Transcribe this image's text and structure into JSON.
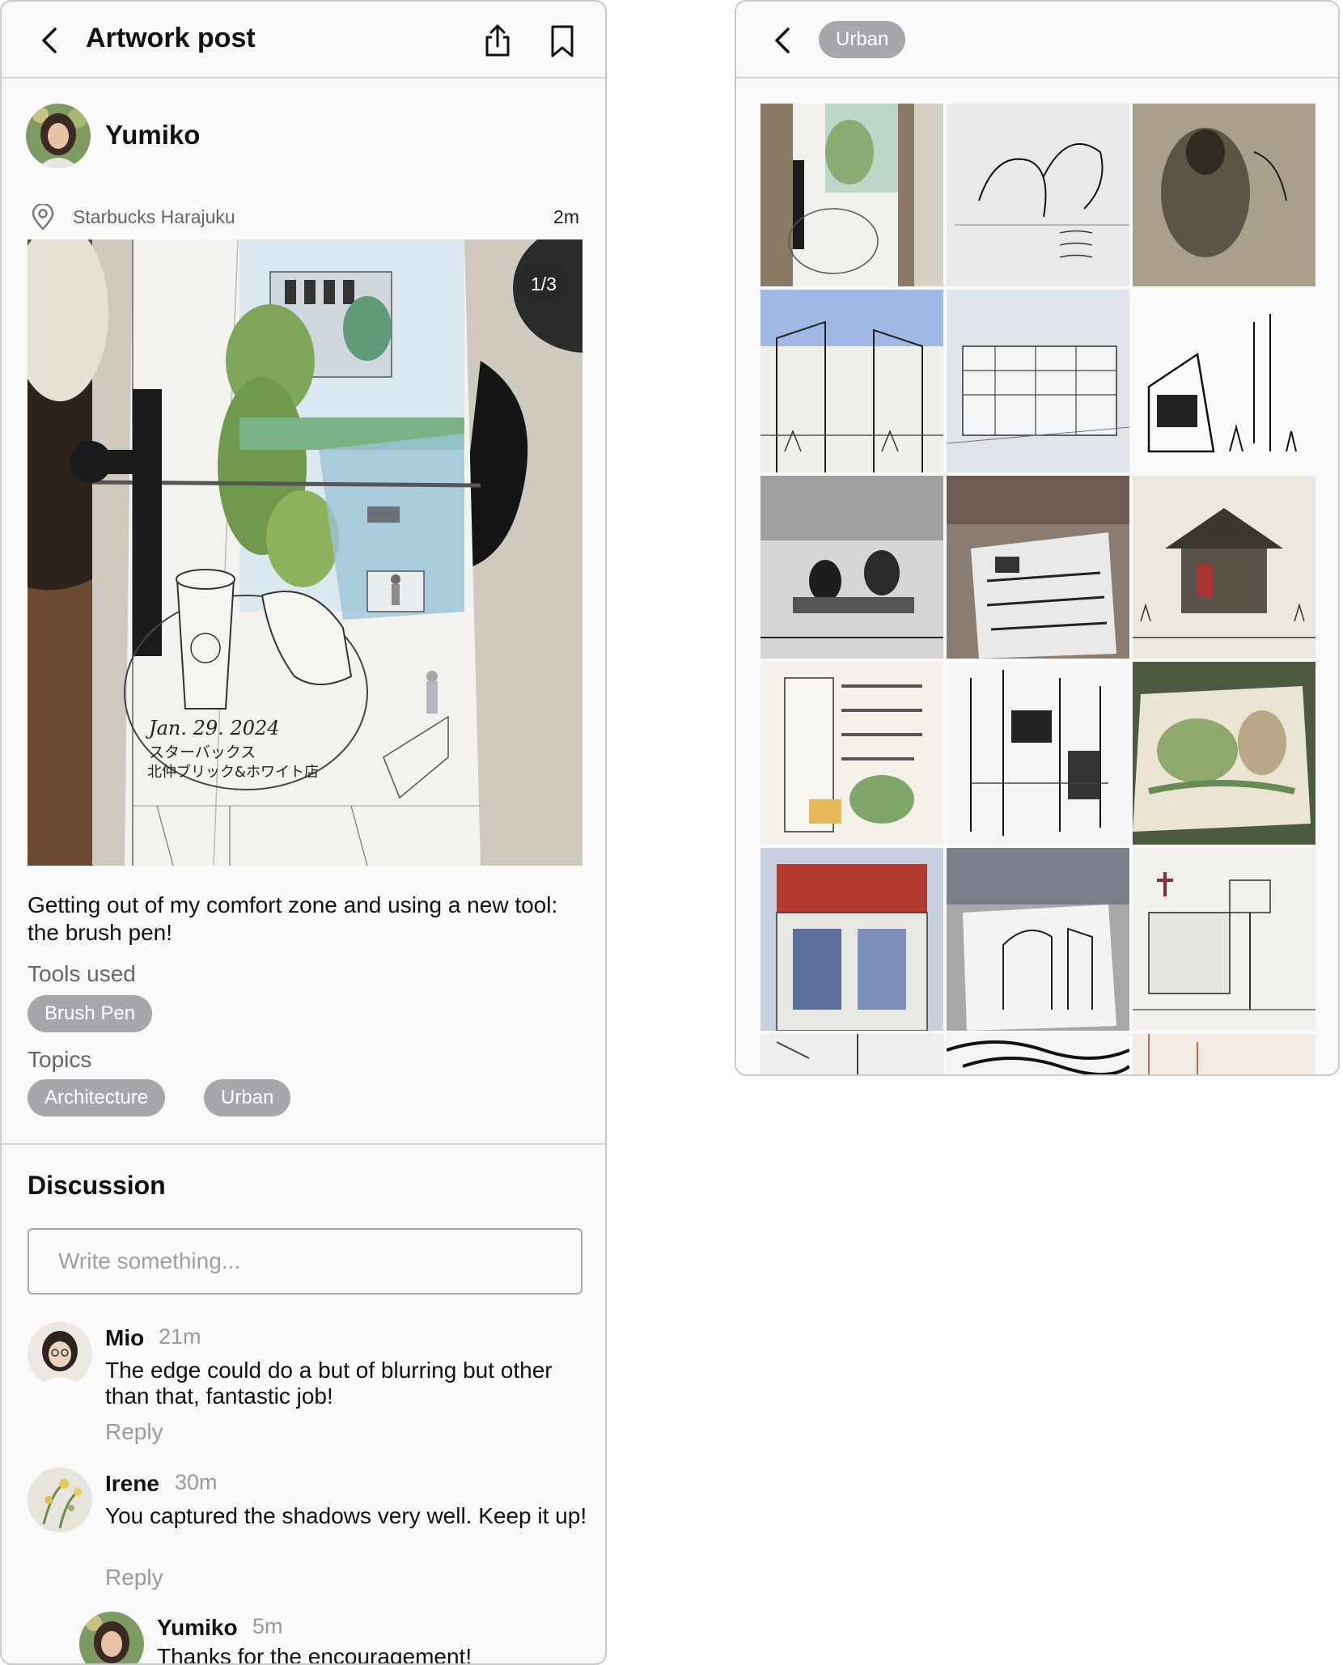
{
  "post_screen": {
    "header": {
      "title": "Artwork post",
      "back_icon": "chevron-left-icon",
      "share_icon": "share-icon",
      "bookmark_icon": "bookmark-icon"
    },
    "author": {
      "name": "Yumiko"
    },
    "location": "Starbucks Harajuku",
    "time": "2m",
    "image_counter": "1/3",
    "artwork_text": {
      "date": "Jan. 29. 2024",
      "line1": "スターバックス",
      "line2": "北仲ブリック&ホワイト店"
    },
    "caption": "Getting out of my comfort zone and using a new tool: the brush pen!",
    "tools_label": "Tools used",
    "tools": [
      "Brush Pen"
    ],
    "topics_label": "Topics",
    "topics": [
      "Architecture",
      "Urban"
    ],
    "discussion": {
      "title": "Discussion",
      "input_placeholder": "Write something...",
      "reply_label": "Reply",
      "comments": [
        {
          "name": "Mio",
          "time": "21m",
          "text": "The edge could do a but of blurring but other than that, fantastic job!"
        },
        {
          "name": "Irene",
          "time": "30m",
          "text": "You captured the shadows very well. Keep it up!"
        }
      ],
      "reply": {
        "name": "Yumiko",
        "time": "5m",
        "text": "Thanks for the encouragement!"
      }
    }
  },
  "topic_screen": {
    "back_icon": "chevron-left-icon",
    "topic": "Urban",
    "gallery_count_visible": 18
  },
  "colors": {
    "chip_bg": "#a7a7ab",
    "panel_bg": "#f9f9f9",
    "border": "#c9c9c9",
    "muted_text": "#9a9a9a"
  }
}
